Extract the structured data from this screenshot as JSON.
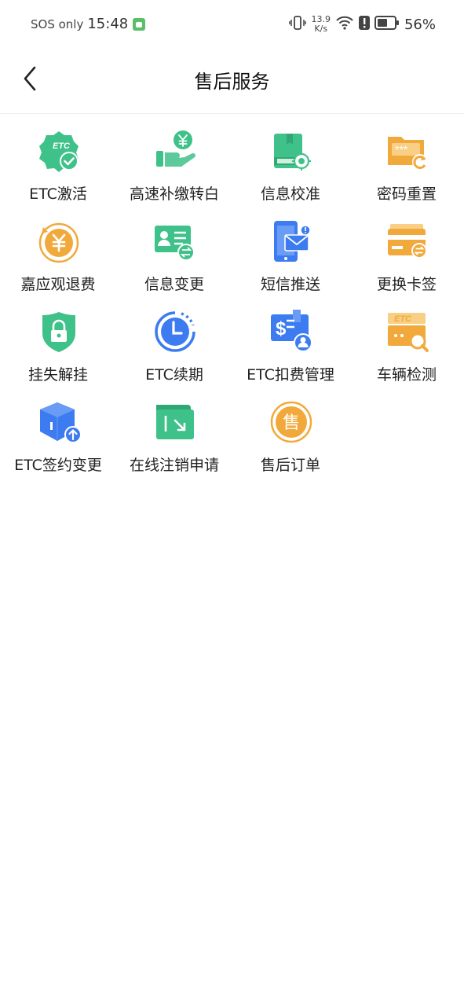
{
  "status_bar": {
    "carrier": "SOS only",
    "time": "15:48",
    "net_speed_value": "13.9",
    "net_speed_unit": "K/s",
    "battery": "56%"
  },
  "header": {
    "title": "售后服务"
  },
  "services": [
    {
      "label": "ETC激活",
      "icon": "etc-badge-check-icon"
    },
    {
      "label": "高速补缴转白",
      "icon": "hand-yen-icon"
    },
    {
      "label": "信息校准",
      "icon": "book-target-icon"
    },
    {
      "label": "密码重置",
      "icon": "folder-password-refresh-icon"
    },
    {
      "label": "嘉应观退费",
      "icon": "yen-coin-refund-icon"
    },
    {
      "label": "信息变更",
      "icon": "id-card-exchange-icon"
    },
    {
      "label": "短信推送",
      "icon": "phone-mail-icon"
    },
    {
      "label": "更换卡签",
      "icon": "card-exchange-icon"
    },
    {
      "label": "挂失解挂",
      "icon": "shield-lock-icon"
    },
    {
      "label": "ETC续期",
      "icon": "clock-renew-icon"
    },
    {
      "label": "ETC扣费管理",
      "icon": "dollar-user-icon"
    },
    {
      "label": "车辆检测",
      "icon": "etc-card-search-icon"
    },
    {
      "label": "ETC签约变更",
      "icon": "box-upload-icon"
    },
    {
      "label": "在线注销申请",
      "icon": "folder-arrow-icon"
    },
    {
      "label": "售后订单",
      "icon": "order-coin-icon"
    }
  ],
  "colors": {
    "green": "#3fc18a",
    "orange": "#f2a93b",
    "blue": "#3d7cf0"
  }
}
